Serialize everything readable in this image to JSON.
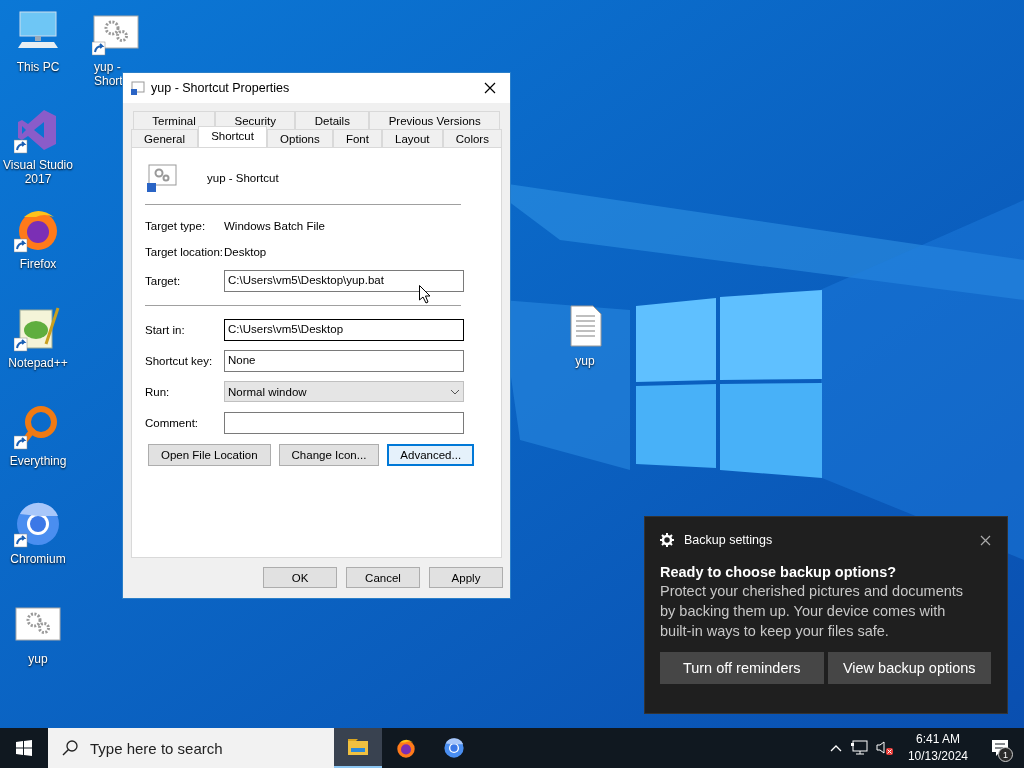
{
  "desktop": {
    "icons": [
      {
        "label": "This PC",
        "kind": "pc",
        "shortcut": false
      },
      {
        "label": "yup - Short",
        "kind": "gears",
        "shortcut": true
      },
      {
        "label": "Visual Studio 2017",
        "kind": "vs",
        "shortcut": true
      },
      {
        "label": "Firefox",
        "kind": "firefox",
        "shortcut": true
      },
      {
        "label": "Notepad++",
        "kind": "notepad",
        "shortcut": true
      },
      {
        "label": "Everything",
        "kind": "everything",
        "shortcut": true
      },
      {
        "label": "Chromium",
        "kind": "chromium",
        "shortcut": true
      },
      {
        "label": "yup",
        "kind": "gears",
        "shortcut": false
      },
      {
        "label": "yup",
        "kind": "file",
        "shortcut": false
      }
    ]
  },
  "dialog": {
    "title": "yup - Shortcut Properties",
    "tab_rows": [
      [
        {
          "label": "Terminal",
          "selected": false
        },
        {
          "label": "Security",
          "selected": false
        },
        {
          "label": "Details",
          "selected": false
        },
        {
          "label": "Previous Versions",
          "selected": false
        }
      ],
      [
        {
          "label": "General",
          "selected": false
        },
        {
          "label": "Shortcut",
          "selected": true
        },
        {
          "label": "Options",
          "selected": false
        },
        {
          "label": "Font",
          "selected": false
        },
        {
          "label": "Layout",
          "selected": false
        },
        {
          "label": "Colors",
          "selected": false
        }
      ]
    ],
    "name": "yup - Shortcut",
    "fields": [
      {
        "kind": "info",
        "label": "Target type:",
        "value": "Windows Batch File"
      },
      {
        "kind": "info",
        "label": "Target location:",
        "value": "Desktop"
      },
      {
        "kind": "input",
        "label": "Target:",
        "value": "C:\\Users\\vm5\\Desktop\\yup.bat",
        "focused": false
      },
      {
        "kind": "separator"
      },
      {
        "kind": "input",
        "label": "Start in:",
        "value": "C:\\Users\\vm5\\Desktop",
        "focused": true
      },
      {
        "kind": "input",
        "label": "Shortcut key:",
        "value": "None",
        "focused": false
      },
      {
        "kind": "select",
        "label": "Run:",
        "value": "Normal window"
      },
      {
        "kind": "input",
        "label": "Comment:",
        "focused": false
      }
    ],
    "actions": [
      {
        "label": "Open File Location",
        "default": false
      },
      {
        "label": "Change Icon...",
        "default": false
      },
      {
        "label": "Advanced...",
        "default": true
      }
    ],
    "buttons": [
      "OK",
      "Cancel",
      "Apply"
    ]
  },
  "notification": {
    "app": "Backup settings",
    "title": "Ready to choose backup options?",
    "body": "Protect your cherished pictures and documents by backing them up. Your device comes with built-in ways to keep your files safe.",
    "buttons": [
      "Turn off reminders",
      "View backup options"
    ]
  },
  "taskbar": {
    "search": {
      "placeholder": "Type here to search"
    },
    "apps": [
      {
        "kind": "explorer",
        "active": true
      },
      {
        "kind": "firefox",
        "active": false
      },
      {
        "kind": "chromium",
        "active": false
      }
    ],
    "time": "6:41 AM",
    "date": "10/13/2024",
    "notification_count": "1"
  }
}
